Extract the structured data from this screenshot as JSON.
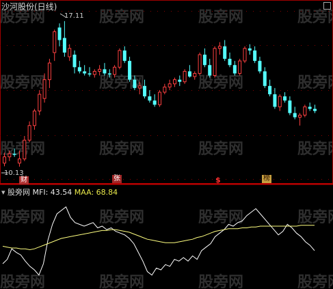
{
  "title": "沙河股份(日线)",
  "watermark": "股旁网",
  "price_panel": {
    "high_label": "17.11",
    "low_label": "10.13",
    "badges": {
      "cai": "财",
      "zhang": "张",
      "s": "$",
      "bang": "榜"
    },
    "colors": {
      "up": "#ff4040",
      "down": "#54ffff",
      "grid": "#8b0000",
      "border": "#b00000"
    }
  },
  "indicator": {
    "name": "MFI",
    "mfi_label": "MFI: 43.54",
    "maa_label": "MAA: 68.84",
    "colors": {
      "mfi": "#ffffff",
      "maa": "#ffff80"
    }
  },
  "chart_data": [
    {
      "type": "candlestick",
      "title": "沙河股份(日线)",
      "ylim": [
        9.8,
        17.4
      ],
      "annotations": [
        "17.11",
        "10.13"
      ],
      "ohlc": [
        [
          10.3,
          10.8,
          10.15,
          10.6
        ],
        [
          10.6,
          10.9,
          10.4,
          10.75
        ],
        [
          10.75,
          11.0,
          10.6,
          10.7
        ],
        [
          10.3,
          10.9,
          10.13,
          10.5
        ],
        [
          10.5,
          11.6,
          10.4,
          11.4
        ],
        [
          11.4,
          12.3,
          11.3,
          12.1
        ],
        [
          12.1,
          12.9,
          11.9,
          12.8
        ],
        [
          12.8,
          13.8,
          12.6,
          13.6
        ],
        [
          13.4,
          14.6,
          13.2,
          14.3
        ],
        [
          14.3,
          15.3,
          13.9,
          15.1
        ],
        [
          15.6,
          16.7,
          15.2,
          16.6
        ],
        [
          16.8,
          17.0,
          15.9,
          16.2
        ],
        [
          16.3,
          17.11,
          15.4,
          15.6
        ],
        [
          15.4,
          16.0,
          15.2,
          15.8
        ],
        [
          15.5,
          15.7,
          14.6,
          14.9
        ],
        [
          14.9,
          15.2,
          14.6,
          14.7
        ],
        [
          14.7,
          15.0,
          14.5,
          14.6
        ],
        [
          14.6,
          14.9,
          14.45,
          14.55
        ],
        [
          14.55,
          14.8,
          14.4,
          14.7
        ],
        [
          14.7,
          15.0,
          14.5,
          14.8
        ],
        [
          14.8,
          15.1,
          14.5,
          14.6
        ],
        [
          14.6,
          14.8,
          14.4,
          14.55
        ],
        [
          14.55,
          15.0,
          14.4,
          14.9
        ],
        [
          14.9,
          15.8,
          14.8,
          15.7
        ],
        [
          15.7,
          15.9,
          15.1,
          15.2
        ],
        [
          15.2,
          15.4,
          14.2,
          14.3
        ],
        [
          14.3,
          14.5,
          13.8,
          13.9
        ],
        [
          13.9,
          14.2,
          13.6,
          14.0
        ],
        [
          14.0,
          14.3,
          13.4,
          13.5
        ],
        [
          13.5,
          13.8,
          13.2,
          13.3
        ],
        [
          13.3,
          13.6,
          13.0,
          13.1
        ],
        [
          13.1,
          13.8,
          13.0,
          13.7
        ],
        [
          13.7,
          14.1,
          13.6,
          13.95
        ],
        [
          13.95,
          14.3,
          13.8,
          14.1
        ],
        [
          14.1,
          14.4,
          13.95,
          14.3
        ],
        [
          14.3,
          14.5,
          14.0,
          14.2
        ],
        [
          14.2,
          14.8,
          14.1,
          14.7
        ],
        [
          14.7,
          15.0,
          14.4,
          14.45
        ],
        [
          14.45,
          14.7,
          14.3,
          14.6
        ],
        [
          14.6,
          15.6,
          14.5,
          15.5
        ],
        [
          15.5,
          15.8,
          14.9,
          15.0
        ],
        [
          15.0,
          15.3,
          14.4,
          14.5
        ],
        [
          14.5,
          15.9,
          14.4,
          15.8
        ],
        [
          15.8,
          16.1,
          15.5,
          15.9
        ],
        [
          15.9,
          16.2,
          15.2,
          15.3
        ],
        [
          15.3,
          15.6,
          14.9,
          15.0
        ],
        [
          15.0,
          15.2,
          14.5,
          14.6
        ],
        [
          14.6,
          15.3,
          14.5,
          15.2
        ],
        [
          15.2,
          15.9,
          15.1,
          15.8
        ],
        [
          15.8,
          16.0,
          15.5,
          15.7
        ],
        [
          15.7,
          15.9,
          15.1,
          15.2
        ],
        [
          15.2,
          15.4,
          14.6,
          14.7
        ],
        [
          14.7,
          14.9,
          13.9,
          14.0
        ],
        [
          14.0,
          14.3,
          13.5,
          13.6
        ],
        [
          13.6,
          13.9,
          12.9,
          13.0
        ],
        [
          13.0,
          13.6,
          12.8,
          13.5
        ],
        [
          13.5,
          13.7,
          13.2,
          13.3
        ],
        [
          13.3,
          13.5,
          12.6,
          12.7
        ],
        [
          12.7,
          13.0,
          12.4,
          12.5
        ],
        [
          12.5,
          12.7,
          12.1,
          12.6
        ],
        [
          12.6,
          13.1,
          12.5,
          13.0
        ],
        [
          13.0,
          13.2,
          12.8,
          12.9
        ],
        [
          12.9,
          13.1,
          12.7,
          12.8
        ]
      ]
    },
    {
      "type": "line",
      "series": [
        {
          "name": "MFI",
          "values": [
            25,
            30,
            42,
            38,
            35,
            28,
            22,
            18,
            12,
            25,
            52,
            70,
            82,
            86,
            90,
            78,
            72,
            70,
            68,
            70,
            72,
            66,
            68,
            64,
            66,
            62,
            60,
            58,
            54,
            48,
            38,
            28,
            16,
            12,
            20,
            18,
            24,
            22,
            30,
            28,
            32,
            28,
            34,
            30,
            40,
            44,
            48,
            56,
            60,
            64,
            70,
            68,
            72,
            74,
            80,
            84,
            88,
            82,
            76,
            70,
            64,
            58,
            62,
            70,
            66,
            60,
            56,
            50,
            46,
            40
          ]
        },
        {
          "name": "MAA",
          "values": [
            45,
            44,
            43,
            43,
            42,
            42,
            41,
            42,
            44,
            46,
            48,
            50,
            52,
            54,
            55,
            56,
            57,
            58,
            59,
            60,
            61,
            62,
            63,
            63,
            64,
            64,
            63,
            62,
            61,
            59,
            57,
            55,
            53,
            52,
            51,
            50,
            49,
            49,
            49,
            50,
            51,
            52,
            53,
            55,
            56,
            58,
            60,
            62,
            63,
            64,
            65,
            65,
            65,
            66,
            66,
            67,
            67,
            68,
            68,
            68,
            68,
            68,
            68,
            68,
            68,
            68,
            69,
            69,
            69,
            69
          ]
        }
      ]
    }
  ]
}
